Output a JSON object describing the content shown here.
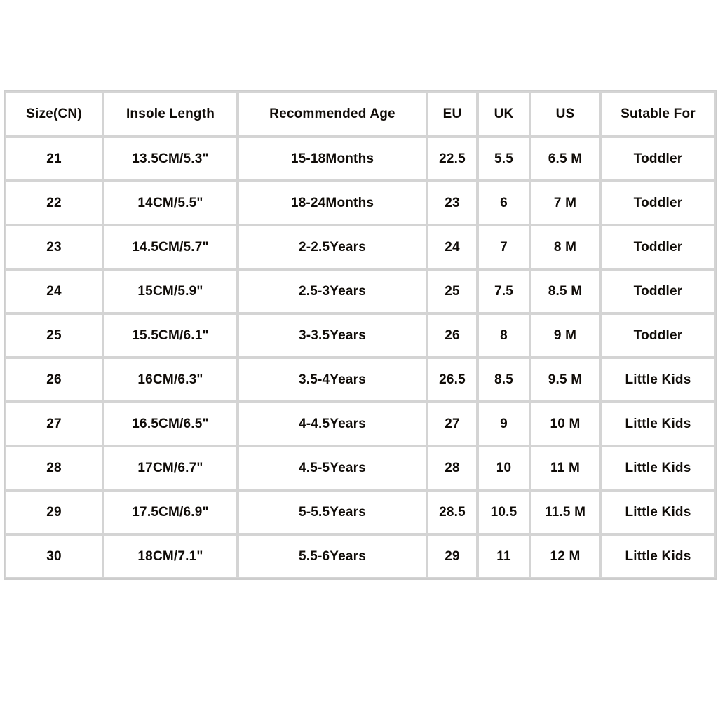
{
  "chart_data": {
    "type": "table",
    "title": "",
    "columns": [
      "Size(CN)",
      "Insole Length",
      "Recommended Age",
      "EU",
      "UK",
      "US",
      "Sutable For"
    ],
    "rows": [
      [
        "21",
        "13.5CM/5.3\"",
        "15-18Months",
        "22.5",
        "5.5",
        "6.5 M",
        "Toddler"
      ],
      [
        "22",
        "14CM/5.5\"",
        "18-24Months",
        "23",
        "6",
        "7 M",
        "Toddler"
      ],
      [
        "23",
        "14.5CM/5.7\"",
        "2-2.5Years",
        "24",
        "7",
        "8 M",
        "Toddler"
      ],
      [
        "24",
        "15CM/5.9\"",
        "2.5-3Years",
        "25",
        "7.5",
        "8.5 M",
        "Toddler"
      ],
      [
        "25",
        "15.5CM/6.1\"",
        "3-3.5Years",
        "26",
        "8",
        "9 M",
        "Toddler"
      ],
      [
        "26",
        "16CM/6.3\"",
        "3.5-4Years",
        "26.5",
        "8.5",
        "9.5 M",
        "Little Kids"
      ],
      [
        "27",
        "16.5CM/6.5\"",
        "4-4.5Years",
        "27",
        "9",
        "10 M",
        "Little Kids"
      ],
      [
        "28",
        "17CM/6.7\"",
        "4.5-5Years",
        "28",
        "10",
        "11 M",
        "Little Kids"
      ],
      [
        "29",
        "17.5CM/6.9\"",
        "5-5.5Years",
        "28.5",
        "10.5",
        "11.5 M",
        "Little Kids"
      ],
      [
        "30",
        "18CM/7.1\"",
        "5.5-6Years",
        "29",
        "11",
        "12 M",
        "Little Kids"
      ]
    ]
  },
  "table": {
    "headers": {
      "size_cn": "Size(CN)",
      "insole_length": "Insole Length",
      "recommended_age": "Recommended Age",
      "eu": "EU",
      "uk": "UK",
      "us": "US",
      "sutable_for": "Sutable For"
    }
  },
  "colors": {
    "background": "#ffffff",
    "text": "#100c08",
    "cell_border": "#d4d4d4",
    "table_border": "#cdcdcd"
  }
}
